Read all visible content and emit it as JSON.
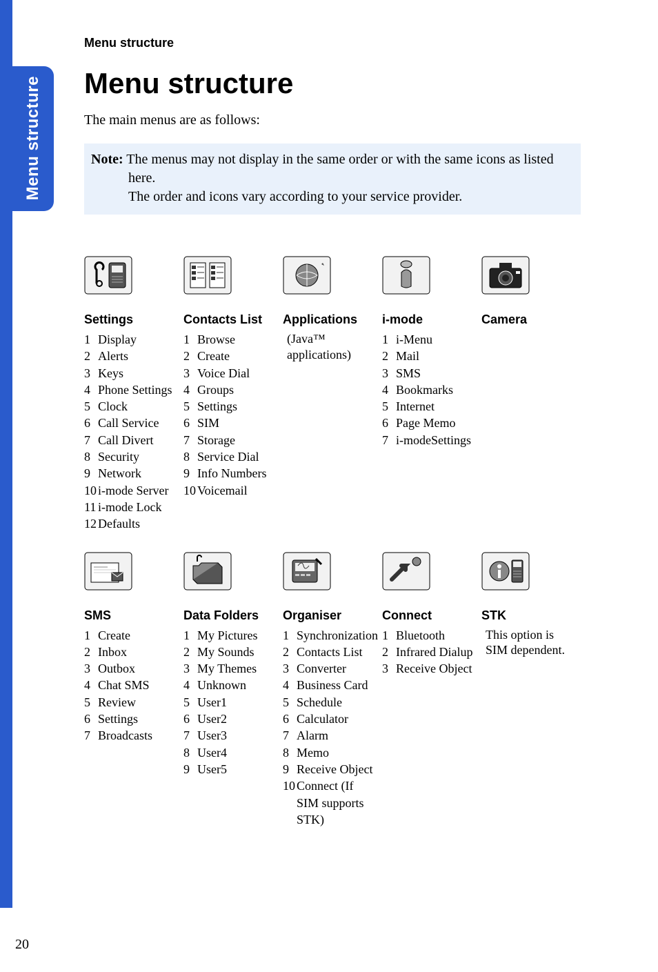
{
  "page_number": "20",
  "side_tab": "Menu structure",
  "running_head": "Menu structure",
  "title": "Menu structure",
  "intro": "The main menus are as follows:",
  "note_label": "Note:",
  "note_text_line1": "The menus may not display in the same order or with the same icons as listed here.",
  "note_text_line2": "The order and icons vary according to your service provider.",
  "menus_row1": [
    {
      "heading": "Settings",
      "items": [
        {
          "n": "1",
          "t": "Display"
        },
        {
          "n": "2",
          "t": "Alerts"
        },
        {
          "n": "3",
          "t": "Keys"
        },
        {
          "n": "4",
          "t": "Phone Settings"
        },
        {
          "n": "5",
          "t": "Clock"
        },
        {
          "n": "6",
          "t": "Call Service"
        },
        {
          "n": "7",
          "t": "Call Divert"
        },
        {
          "n": "8",
          "t": "Security"
        },
        {
          "n": "9",
          "t": "Network"
        },
        {
          "n": "10",
          "t": "i-mode Server"
        },
        {
          "n": "11",
          "t": "i-mode Lock"
        },
        {
          "n": "12",
          "t": "Defaults"
        }
      ],
      "note_html": ""
    },
    {
      "heading": "Contacts List",
      "items": [
        {
          "n": "1",
          "t": "Browse"
        },
        {
          "n": "2",
          "t": "Create"
        },
        {
          "n": "3",
          "t": "Voice Dial"
        },
        {
          "n": "4",
          "t": "Groups"
        },
        {
          "n": "5",
          "t": "Settings"
        },
        {
          "n": "6",
          "t": "SIM"
        },
        {
          "n": "7",
          "t": "Storage"
        },
        {
          "n": "8",
          "t": "Service Dial"
        },
        {
          "n": "9",
          "t": "Info Numbers"
        },
        {
          "n": "10",
          "t": "Voicemail"
        }
      ],
      "note_html": ""
    },
    {
      "heading": "Applications",
      "items": [],
      "note_html": "(Java™ applications)"
    },
    {
      "heading": "i-mode",
      "items": [
        {
          "n": "1",
          "t": "i-Menu"
        },
        {
          "n": "2",
          "t": "Mail"
        },
        {
          "n": "3",
          "t": "SMS"
        },
        {
          "n": "4",
          "t": "Bookmarks"
        },
        {
          "n": "5",
          "t": "Internet"
        },
        {
          "n": "6",
          "t": "Page Memo"
        },
        {
          "n": "7",
          "t": "i-modeSettings"
        }
      ],
      "note_html": ""
    },
    {
      "heading": "Camera",
      "items": [],
      "note_html": ""
    }
  ],
  "menus_row2": [
    {
      "heading": "SMS",
      "items": [
        {
          "n": "1",
          "t": "Create"
        },
        {
          "n": "2",
          "t": "Inbox"
        },
        {
          "n": "3",
          "t": "Outbox"
        },
        {
          "n": "4",
          "t": "Chat SMS"
        },
        {
          "n": "5",
          "t": "Review"
        },
        {
          "n": "6",
          "t": "Settings"
        },
        {
          "n": "7",
          "t": "Broadcasts"
        }
      ],
      "note_html": ""
    },
    {
      "heading": "Data Folders",
      "items": [
        {
          "n": "1",
          "t": "My Pictures"
        },
        {
          "n": "2",
          "t": "My Sounds"
        },
        {
          "n": "3",
          "t": "My Themes"
        },
        {
          "n": "4",
          "t": "Unknown"
        },
        {
          "n": "5",
          "t": "User1"
        },
        {
          "n": "6",
          "t": "User2"
        },
        {
          "n": "7",
          "t": "User3"
        },
        {
          "n": "8",
          "t": "User4"
        },
        {
          "n": "9",
          "t": "User5"
        }
      ],
      "note_html": ""
    },
    {
      "heading": "Organiser",
      "items": [
        {
          "n": "1",
          "t": "Synchronization"
        },
        {
          "n": "2",
          "t": "Contacts List"
        },
        {
          "n": "3",
          "t": "Converter"
        },
        {
          "n": "4",
          "t": "Business Card"
        },
        {
          "n": "5",
          "t": "Schedule"
        },
        {
          "n": "6",
          "t": "Calculator"
        },
        {
          "n": "7",
          "t": "Alarm"
        },
        {
          "n": "8",
          "t": "Memo"
        },
        {
          "n": "9",
          "t": "Receive Object"
        },
        {
          "n": "10",
          "t": "Connect (If SIM supports STK)"
        }
      ],
      "note_html": ""
    },
    {
      "heading": "Connect",
      "items": [
        {
          "n": "1",
          "t": "Bluetooth"
        },
        {
          "n": "2",
          "t": "Infrared Dialup"
        },
        {
          "n": "3",
          "t": "Receive Object"
        }
      ],
      "note_html": ""
    },
    {
      "heading": "STK",
      "items": [],
      "note_html": "This option is SIM dependent."
    }
  ]
}
